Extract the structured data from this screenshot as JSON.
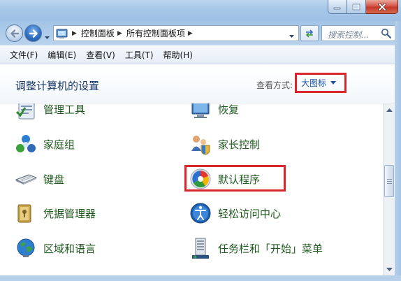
{
  "window": {
    "caption_buttons": [
      {
        "name": "minimize",
        "icon": "minimize-icon"
      },
      {
        "name": "maximize",
        "icon": "maximize-icon"
      },
      {
        "name": "close",
        "icon": "close-icon"
      }
    ]
  },
  "navigation": {
    "breadcrumb": [
      "控制面板",
      "所有控制面板项"
    ],
    "search_placeholder": "搜索控制..."
  },
  "menu": [
    "文件(F)",
    "编辑(E)",
    "查看(V)",
    "工具(T)",
    "帮助(H)"
  ],
  "header": {
    "title": "调整计算机的设置",
    "view_by_label": "查看方式:",
    "view_by_value": "大图标"
  },
  "items": [
    {
      "label": "管理工具",
      "icon": "admin-tools-icon"
    },
    {
      "label": "恢复",
      "icon": "recovery-icon"
    },
    {
      "label": "家庭组",
      "icon": "homegroup-icon"
    },
    {
      "label": "家长控制",
      "icon": "parental-controls-icon"
    },
    {
      "label": "键盘",
      "icon": "keyboard-icon"
    },
    {
      "label": "默认程序",
      "icon": "default-programs-icon",
      "highlighted": true
    },
    {
      "label": "凭据管理器",
      "icon": "credential-manager-icon"
    },
    {
      "label": "轻松访问中心",
      "icon": "ease-of-access-icon"
    },
    {
      "label": "区域和语言",
      "icon": "region-language-icon"
    },
    {
      "label": "任务栏和「开始」菜单",
      "icon": "taskbar-start-menu-icon"
    }
  ],
  "colors": {
    "highlight_border": "#d9252c",
    "item_text": "#1f5a1f",
    "title_text": "#1b3a6b",
    "link_text": "#1a55a8"
  }
}
